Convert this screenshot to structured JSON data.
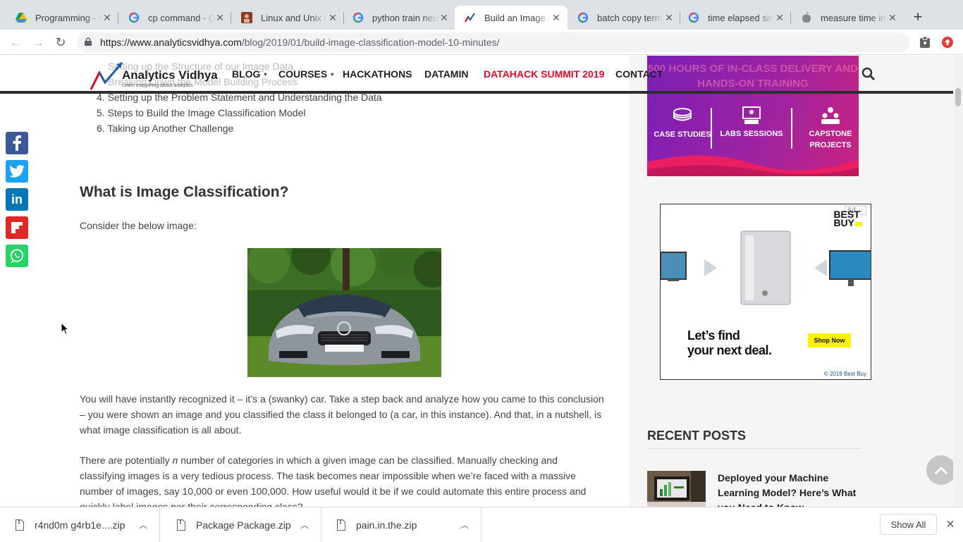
{
  "browser": {
    "tabs": [
      {
        "title": "Programming - G",
        "icon": "google-drive-icon"
      },
      {
        "title": "cp command - G",
        "icon": "google-icon"
      },
      {
        "title": "Linux and Unix c",
        "icon": "site-icon"
      },
      {
        "title": "python train neu",
        "icon": "google-icon"
      },
      {
        "title": "Build an Image C",
        "icon": "analytics-vidhya-icon",
        "active": true
      },
      {
        "title": "batch copy term",
        "icon": "google-icon"
      },
      {
        "title": "time elapsed sin",
        "icon": "google-icon"
      },
      {
        "title": "measure time in",
        "icon": "apple-icon"
      }
    ],
    "url_host": "https://www.analyticsvidhya.com",
    "url_path": "/blog/2019/01/build-image-classification-model-10-minutes/"
  },
  "site": {
    "logo_text": "Analytics Vidhya",
    "logo_tagline": "Learn everything about analytics",
    "menu": {
      "blog": "BLOG",
      "courses": "COURSES",
      "hackathons": "HACKATHONS",
      "datamin": "DATAMIN",
      "summit": "DATAHACK SUMMIT 2019",
      "contact": "CONTACT"
    },
    "accent_red": "#e3092a"
  },
  "article": {
    "toc_ghost": [
      "Setting up the Structure of our Image Data",
      "Breaking Down the Model Building Process"
    ],
    "toc": [
      "4. Setting up the Problem Statement and Understanding the Data",
      "5. Steps to Build the Image Classification Model",
      "6. Taking up Another Challenge"
    ],
    "heading": "What is Image Classification?",
    "intro": "Consider the below image:",
    "p1": "You will have instantly recognized it – it’s a (swanky) car. Take a step back and analyze how you came to this conclusion – you were shown an image and you classified the class it belonged to (a car, in this instance). And that, in a nutshell, is what image classification is all about.",
    "p2_a": "There are potentially ",
    "p2_n": "n",
    "p2_b": " number of categories in which a given image can be classified. Manually checking and classifying images is a very tedious process. The task becomes near impossible when we’re faced with a massive number of images, say 10,000 or even 100,000. How useful would it be if we could automate this entire process and quickly label images per their corresponding class?"
  },
  "banner": {
    "title": "500 HOURS OF IN-CLASS DELIVERY AND HANDS-ON TRAINING",
    "items": [
      "CASE STUDIES",
      "LABS SESSIONS",
      "CAPSTONE PROJECTS"
    ]
  },
  "ad": {
    "label": "Ad",
    "brand": "BEST BUY",
    "headline_1": "Let’s find",
    "headline_2": "your next deal.",
    "cta": "Shop Now",
    "copyright": "© 2019 Best Buy"
  },
  "sidebar": {
    "recent_title": "RECENT POSTS",
    "post_title": "Deployed your Machine Learning Model? Here’s What you Need to Know"
  },
  "downloads": {
    "files": [
      "r4nd0m g4rb1e....zip",
      "Package Package.zip",
      "pain.in.the.zip"
    ],
    "show_all": "Show All"
  }
}
